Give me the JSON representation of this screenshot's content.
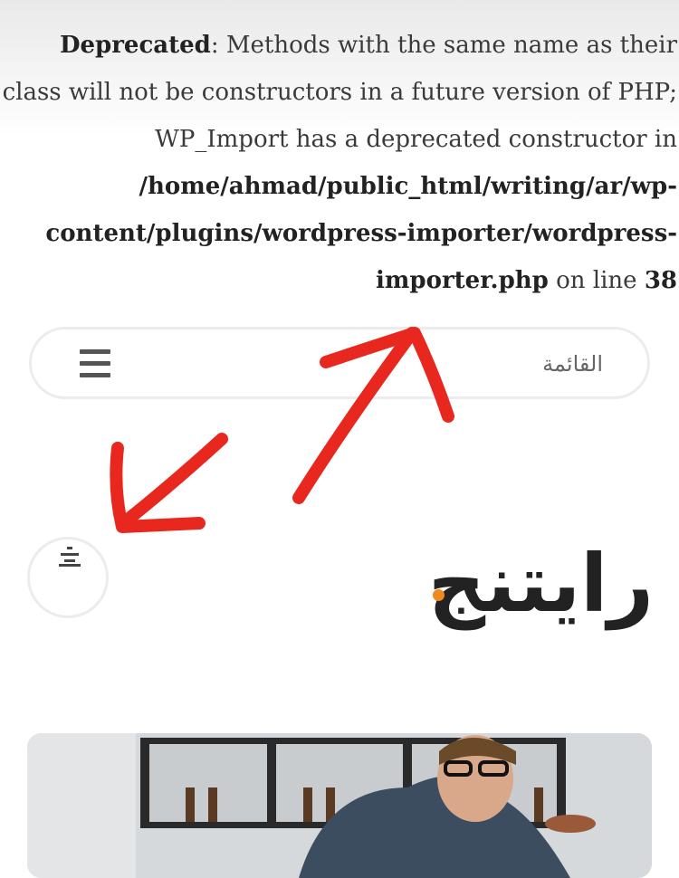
{
  "notice": {
    "label": "Deprecated",
    "text_1": ": Methods with the same name as their class will not be constructors in a future version of PHP; WP_Import has a deprecated constructor in ",
    "path": "/home/ahmad/public_html/writing/ar/wp-content/plugins/wordpress-importer/wordpress-importer.php",
    "text_2": " on line ",
    "line": "38"
  },
  "nav": {
    "menu_label": "القائمة",
    "menu_icon": "hamburger-icon"
  },
  "toggle": {
    "icon": "menu-toggle-icon"
  },
  "site": {
    "logo_text": "رايتنج"
  },
  "annotations": {
    "color": "#e8281f"
  },
  "colors": {
    "logo_dot": "#f08a1c",
    "border": "#ececec"
  }
}
